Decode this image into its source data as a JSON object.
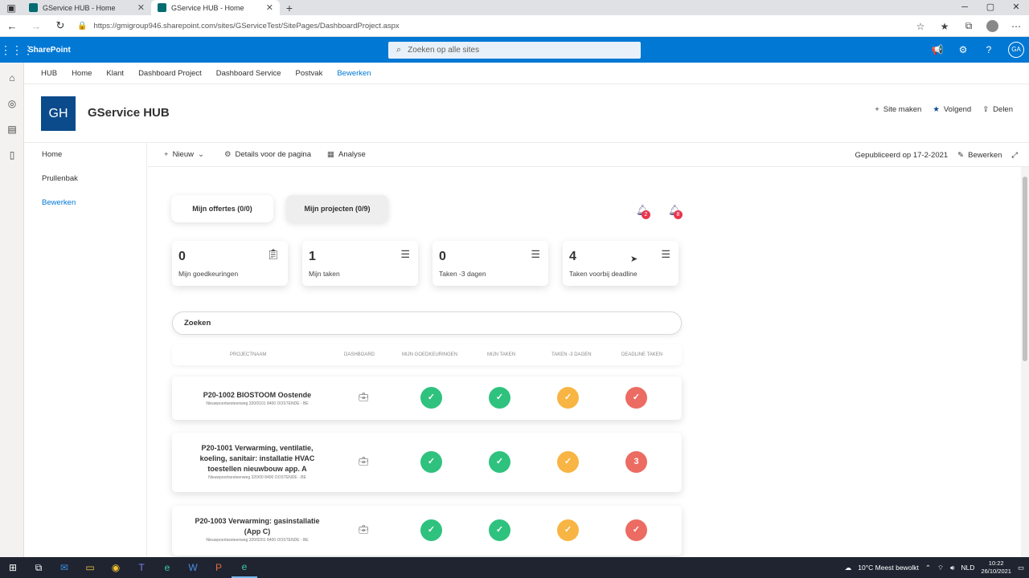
{
  "browser": {
    "tabs": [
      {
        "title": "GService HUB - Home",
        "active": false
      },
      {
        "title": "GService HUB - Home",
        "active": true
      }
    ],
    "url": "https://gmigroup946.sharepoint.com/sites/GServiceTest/SitePages/DashboardProject.aspx",
    "window_controls": [
      "─",
      "▢",
      "✕"
    ]
  },
  "suite": {
    "app_name": "SharePoint",
    "search_placeholder": "Zoeken op alle sites",
    "avatar": "GA"
  },
  "hubnav": {
    "items": [
      "HUB",
      "Home",
      "Klant",
      "Dashboard Project",
      "Dashboard Service",
      "Postvak"
    ],
    "edit": "Bewerken"
  },
  "site": {
    "logo": "GH",
    "title": "GService HUB",
    "actions": {
      "create": "Site maken",
      "follow": "Volgend",
      "share": "Delen"
    }
  },
  "quicklaunch": {
    "items": [
      "Home",
      "Prullenbak"
    ],
    "edit": "Bewerken"
  },
  "commandbar": {
    "new": "Nieuw",
    "details": "Details voor de pagina",
    "analysis": "Analyse",
    "published": "Gepubliceerd op 17-2-2021",
    "edit": "Bewerken"
  },
  "dashboard": {
    "tabs": {
      "offers": "Mijn offertes (0/0)",
      "projects": "Mijn projecten (0/9)"
    },
    "notifications": [
      {
        "icon": "bell-icon",
        "count": "2"
      },
      {
        "icon": "bell-icon",
        "count": "8"
      }
    ],
    "cards": [
      {
        "value": "0",
        "label": "Mijn goedkeuringen",
        "icon": "clipboard-check-icon"
      },
      {
        "value": "1",
        "label": "Mijn taken",
        "icon": "list-check-icon"
      },
      {
        "value": "0",
        "label": "Taken -3 dagen",
        "icon": "list-check-icon"
      },
      {
        "value": "4",
        "label": "Taken voorbij deadline",
        "icon": "list-check-icon"
      }
    ],
    "search_placeholder": "Zoeken",
    "columns": [
      "PROJECTNAAM",
      "DASHBOARD",
      "MIJN GOEDKEURINGEN",
      "MIJN TAKEN",
      "TAKEN -3 DAGEN",
      "DEADLINE TAKEN"
    ],
    "rows": [
      {
        "name": "P20-1002 BIOSTOOM Oostende",
        "address": "Nieuwpoortsesteenweg 320/0101 8400 OOSTENDE - BE",
        "statuses": [
          {
            "color": "green",
            "glyph": "✓"
          },
          {
            "color": "green",
            "glyph": "✓"
          },
          {
            "color": "orange",
            "glyph": "✓"
          },
          {
            "color": "red",
            "glyph": "✓"
          }
        ]
      },
      {
        "name": "P20-1001 Verwarming, ventilatie, koeling, sanitair: installatie HVAC toestellen nieuwbouw app. A",
        "address": "Nieuwpoortsesteenweg 320/00 8400 OOSTENDE - BE",
        "statuses": [
          {
            "color": "green",
            "glyph": "✓"
          },
          {
            "color": "green",
            "glyph": "✓"
          },
          {
            "color": "orange",
            "glyph": "✓"
          },
          {
            "color": "red",
            "glyph": "3"
          }
        ]
      },
      {
        "name": "P20-1003 Verwarming: gasinstallatie (App C)",
        "address": "Nieuwpoortsesteenweg 320/0201 8400 OOSTENDE - BE",
        "statuses": [
          {
            "color": "green",
            "glyph": "✓"
          },
          {
            "color": "green",
            "glyph": "✓"
          },
          {
            "color": "orange",
            "glyph": "✓"
          },
          {
            "color": "red",
            "glyph": "✓"
          }
        ]
      }
    ]
  },
  "taskbar": {
    "weather": "10°C  Meest bewolkt",
    "language": "NLD",
    "time": "10:22",
    "date": "26/10/2021"
  },
  "colors": {
    "suite_blue": "#0078d4",
    "logo_blue": "#0b4a8b",
    "status_green": "#2ec27e",
    "status_orange": "#f8b544",
    "status_red": "#ec6b62"
  }
}
